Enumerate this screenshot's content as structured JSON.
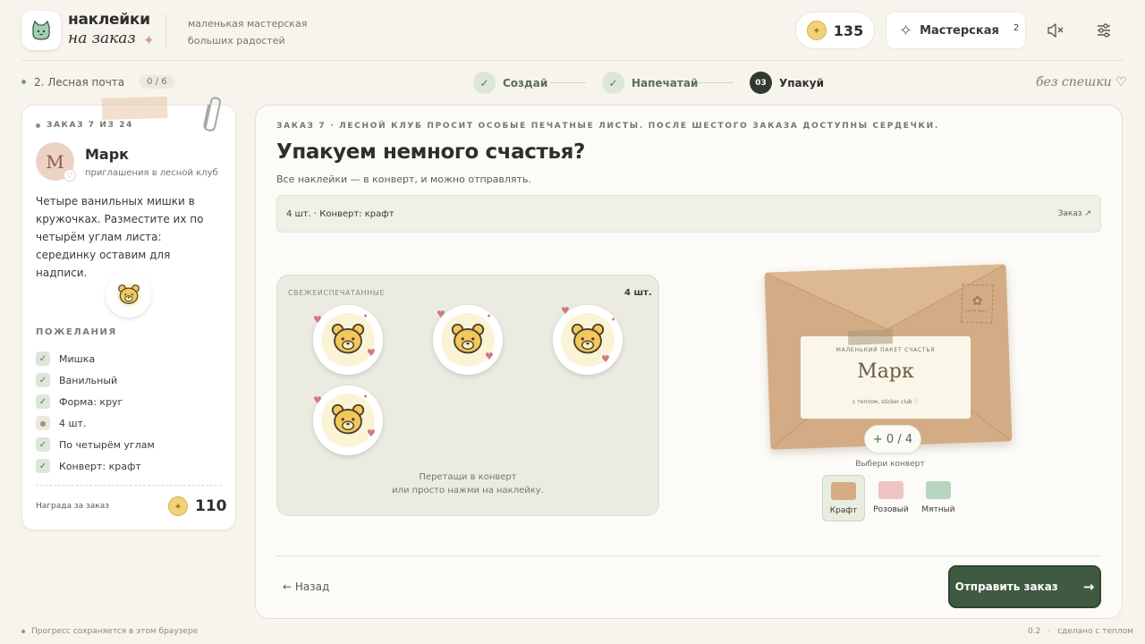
{
  "header": {
    "logo_line1": "наклейки",
    "logo_line2": "на заказ",
    "tagline_line1": "маленькая мастерская",
    "tagline_line2": "больших радостей",
    "coins": "135",
    "workshop_label": "Мастерская",
    "workshop_badge": "2",
    "icons": [
      "cat-logo-icon",
      "sparkle-icon",
      "coin-icon",
      "sparkle-star-icon",
      "mute-icon",
      "settings-sliders-icon"
    ]
  },
  "subheader": {
    "chapter": "2. Лесная почта",
    "chapter_progress": "0 / 6",
    "steps": [
      {
        "label": "Создай",
        "marker": "✓",
        "state": "done"
      },
      {
        "label": "Напечатай",
        "marker": "✓",
        "state": "done"
      },
      {
        "label": "Упакуй",
        "marker": "03",
        "state": "active"
      }
    ],
    "slow_mode": "без спешки ♡"
  },
  "order_card": {
    "order_label": "ЗАКАЗ 7 ИЗ 24",
    "avatar_letter": "М",
    "customer_name": "Марк",
    "customer_sub": "приглашения в лесной клуб",
    "brief": "Четыре ванильных мишки в кружочках. Разместите их по четырём углам листа: серединку оставим для надписи.",
    "wishes_title": "ПОЖЕЛАНИЯ",
    "wishes": [
      {
        "label": "Мишка",
        "done": true
      },
      {
        "label": "Ванильный",
        "done": true
      },
      {
        "label": "Форма: круг",
        "done": true
      },
      {
        "label": "4 шт.",
        "done": false
      },
      {
        "label": "По четырём углам",
        "done": true
      },
      {
        "label": "Конверт: крафт",
        "done": true
      }
    ],
    "reward_label": "Награда за заказ",
    "reward_value": "110"
  },
  "main": {
    "order_line": "ЗАКАЗ 7 · ЛЕСНОЙ КЛУБ ПРОСИТ ОСОБЫЕ ПЕЧАТНЫЕ ЛИСТЫ. ПОСЛЕ ШЕСТОГО ЗАКАЗА ДОСТУПНЫ СЕРДЕЧКИ.",
    "title": "Упакуем немного счастья?",
    "subtitle": "Все наклейки — в конверт, и можно отправлять.",
    "strip_text": "4 шт. · Конверт: крафт",
    "strip_link": "Заказ ↗",
    "fresh_label": "СВЕЖЕИСПЕЧАТАННЫЕ",
    "fresh_count": "4 шт.",
    "hint_line1": "Перетащи в конверт",
    "hint_line2": "или просто нажми на наклейку.",
    "envelope": {
      "small_label": "МАЛЕНЬКИЙ ПАКЕТ СЧАСТЬЯ",
      "name": "Марк",
      "footer": "с теплом, sticker club ♡",
      "stamp_text": "LOVE MAIL",
      "counter": "+ 0 / 4"
    },
    "choose_label": "Выбери конверт",
    "envelope_options": [
      {
        "label": "Крафт",
        "color": "#d5ac84",
        "selected": true
      },
      {
        "label": "Розовый",
        "color": "#f0c4c0",
        "selected": false
      },
      {
        "label": "Мятный",
        "color": "#b8d5bf",
        "selected": false
      }
    ],
    "back_label": "← Назад",
    "send_label": "Отправить заказ",
    "send_arrow": "→"
  },
  "footer": {
    "left": "Прогресс сохраняется в этом браузере",
    "version": "0.2",
    "sep": "·",
    "right": "сделано с теплом"
  },
  "colors": {
    "accent_green": "#3f5a40",
    "kraft": "#d3ac85",
    "background": "#f6f4ec"
  }
}
